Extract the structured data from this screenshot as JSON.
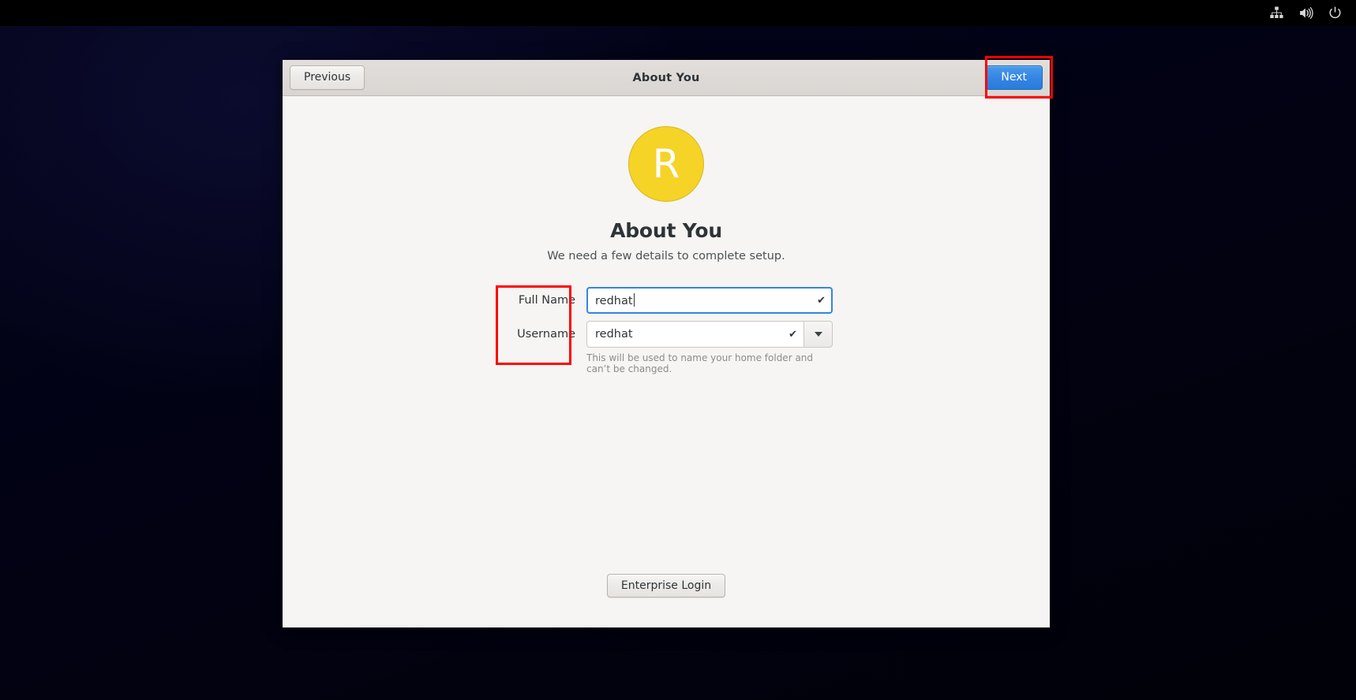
{
  "top_panel": {
    "icons": [
      {
        "name": "network-wired-icon",
        "label": "Network"
      },
      {
        "name": "volume-icon",
        "label": "Volume"
      },
      {
        "name": "power-icon",
        "label": "Power"
      }
    ]
  },
  "window": {
    "headerbar": {
      "previous_label": "Previous",
      "title": "About You",
      "next_label": "Next"
    },
    "avatar": {
      "initial": "R",
      "background_color": "#f5d327",
      "text_color": "#ffffff"
    },
    "page": {
      "title": "About You",
      "subtitle": "We need a few details to complete setup."
    },
    "form": {
      "full_name": {
        "label": "Full Name",
        "value": "redhat",
        "placeholder": "",
        "valid_icon": "✔",
        "focused": true
      },
      "username": {
        "label": "Username",
        "value": "redhat",
        "placeholder": "",
        "valid_icon": "✔",
        "dropdown_icon": "chevron-down-icon",
        "hint": "This will be used to name your home folder and can’t be changed."
      }
    },
    "enterprise_login_label": "Enterprise Login"
  },
  "annotations": {
    "highlight_color": "#ff0000",
    "boxes": [
      {
        "name": "next-button-highlight",
        "target": "Next"
      },
      {
        "name": "form-labels-highlight",
        "target": "Full Name / Username"
      }
    ]
  },
  "colors": {
    "accent": "#3584e4",
    "desktop_background": "#04041c",
    "window_background": "#f6f5f4",
    "headerbar_background": "#dad6d2"
  }
}
